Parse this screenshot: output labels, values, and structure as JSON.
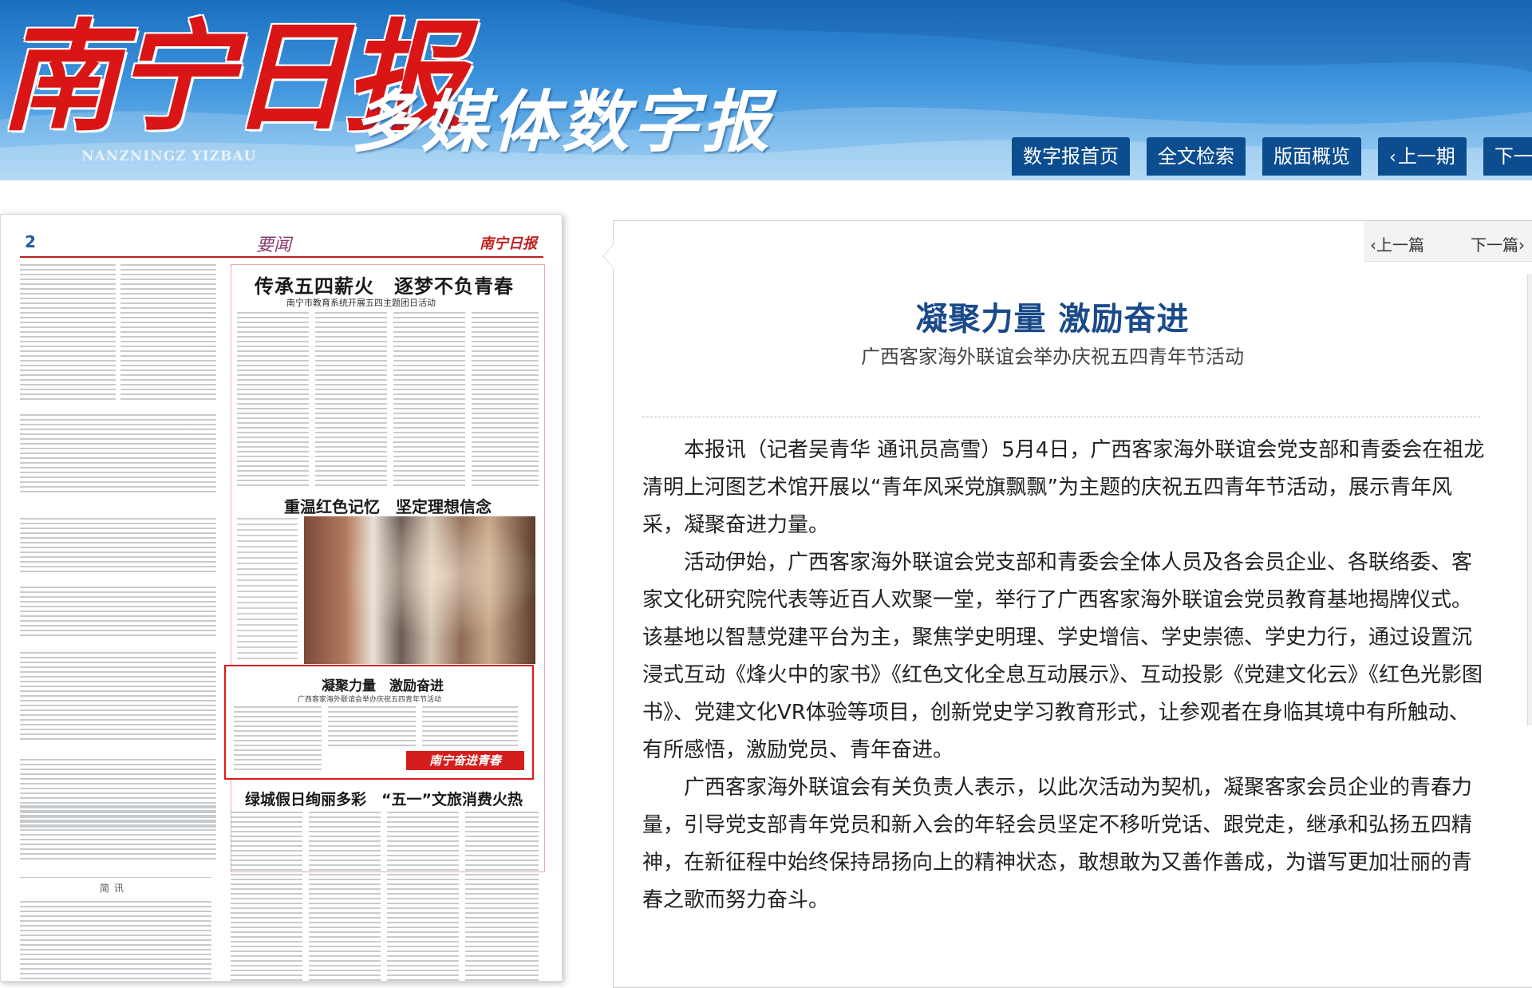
{
  "header": {
    "logo_text": "南宁日报",
    "logo_pinyin": "NANZNINGZ YIZBAU",
    "tagline": "多媒体数字报",
    "nav": [
      {
        "label": "数字报首页",
        "icon": ""
      },
      {
        "label": "全文检索",
        "icon": ""
      },
      {
        "label": "版面概览",
        "icon": ""
      },
      {
        "label": "上一期",
        "icon": "chevron-left-icon"
      },
      {
        "label": "下一期",
        "icon": ""
      }
    ]
  },
  "paper_page": {
    "page_number": "2",
    "section": "要闻",
    "brand": "南宁日报",
    "headline_1": "传承五四薪火　逐梦不负青春",
    "subhead_1": "南宁市教育系统开展五四主题团日活动",
    "headline_2": "重温红色记忆　坚定理想信念",
    "selected_title": "凝聚力量　激励奋进",
    "selected_sub": "广西客家海外联谊会举办庆祝五四青年节活动",
    "selected_stamp": "南宁奋进青春",
    "headline_3": "绿城假日绚丽多彩　“五一”文旅消费火热",
    "brief_label": "简讯"
  },
  "article": {
    "prev_label": "上一篇",
    "next_label": "下一篇",
    "title": "凝聚力量 激励奋进",
    "subtitle": "广西客家海外联谊会举办庆祝五四青年节活动",
    "paragraphs": [
      "本报讯（记者吴青华 通讯员高雪）5月4日，广西客家海外联谊会党支部和青委会在祖龙清明上河图艺术馆开展以“青年风采党旗飘飘”为主题的庆祝五四青年节活动，展示青年风采，凝聚奋进力量。",
      "活动伊始，广西客家海外联谊会党支部和青委会全体人员及各会员企业、各联络委、客家文化研究院代表等近百人欢聚一堂，举行了广西客家海外联谊会党员教育基地揭牌仪式。该基地以智慧党建平台为主，聚焦学史明理、学史增信、学史崇德、学史力行，通过设置沉浸式互动《烽火中的家书》《红色文化全息互动展示》、互动投影《党建文化云》《红色光影图书》、党建文化VR体验等项目，创新党史学习教育形式，让参观者在身临其境中有所触动、有所感悟，激励党员、青年奋进。",
      "广西客家海外联谊会有关负责人表示，以此次活动为契机，凝聚客家会员企业的青春力量，引导党支部青年党员和新入会的年轻会员坚定不移听党话、跟党走，继承和弘扬五四精神，在新征程中始终保持昂扬向上的精神状态，敢想敢为又善作善成，为谱写更加壮丽的青春之歌而努力奋斗。"
    ]
  },
  "colors": {
    "nav_bg": "#0c4d8f",
    "title_blue": "#1a4a8a",
    "logo_red": "#d91515",
    "selection_red": "#e01818"
  }
}
